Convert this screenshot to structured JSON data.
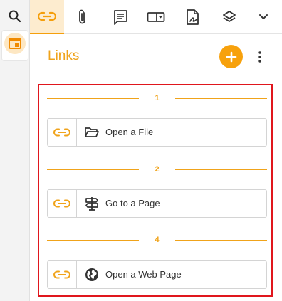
{
  "toolbar": {
    "items": [
      {
        "icon": "link-icon",
        "active": true
      },
      {
        "icon": "paperclip-icon",
        "active": false
      },
      {
        "icon": "comment-icon",
        "active": false
      },
      {
        "icon": "form-field-icon",
        "active": false
      },
      {
        "icon": "signature-icon",
        "active": false
      },
      {
        "icon": "layers-icon",
        "active": false
      },
      {
        "icon": "chevron-down-icon",
        "active": false
      }
    ]
  },
  "rail": {
    "items": [
      {
        "icon": "search-icon"
      },
      {
        "icon": "panel-icon",
        "active": true
      }
    ]
  },
  "panel": {
    "title": "Links",
    "add_icon": "plus-icon",
    "more_icon": "more-vertical-icon"
  },
  "groups": [
    {
      "page": "1",
      "link": {
        "label": "Open a File",
        "icon": "folder-open-icon"
      }
    },
    {
      "page": "2",
      "link": {
        "label": "Go to a Page",
        "icon": "signpost-icon"
      }
    },
    {
      "page": "4",
      "link": {
        "label": "Open a Web Page",
        "icon": "globe-icon"
      }
    }
  ],
  "colors": {
    "accent": "#f0a31a",
    "accent_strong": "#f7a10c",
    "highlight_frame": "#e0161d"
  }
}
